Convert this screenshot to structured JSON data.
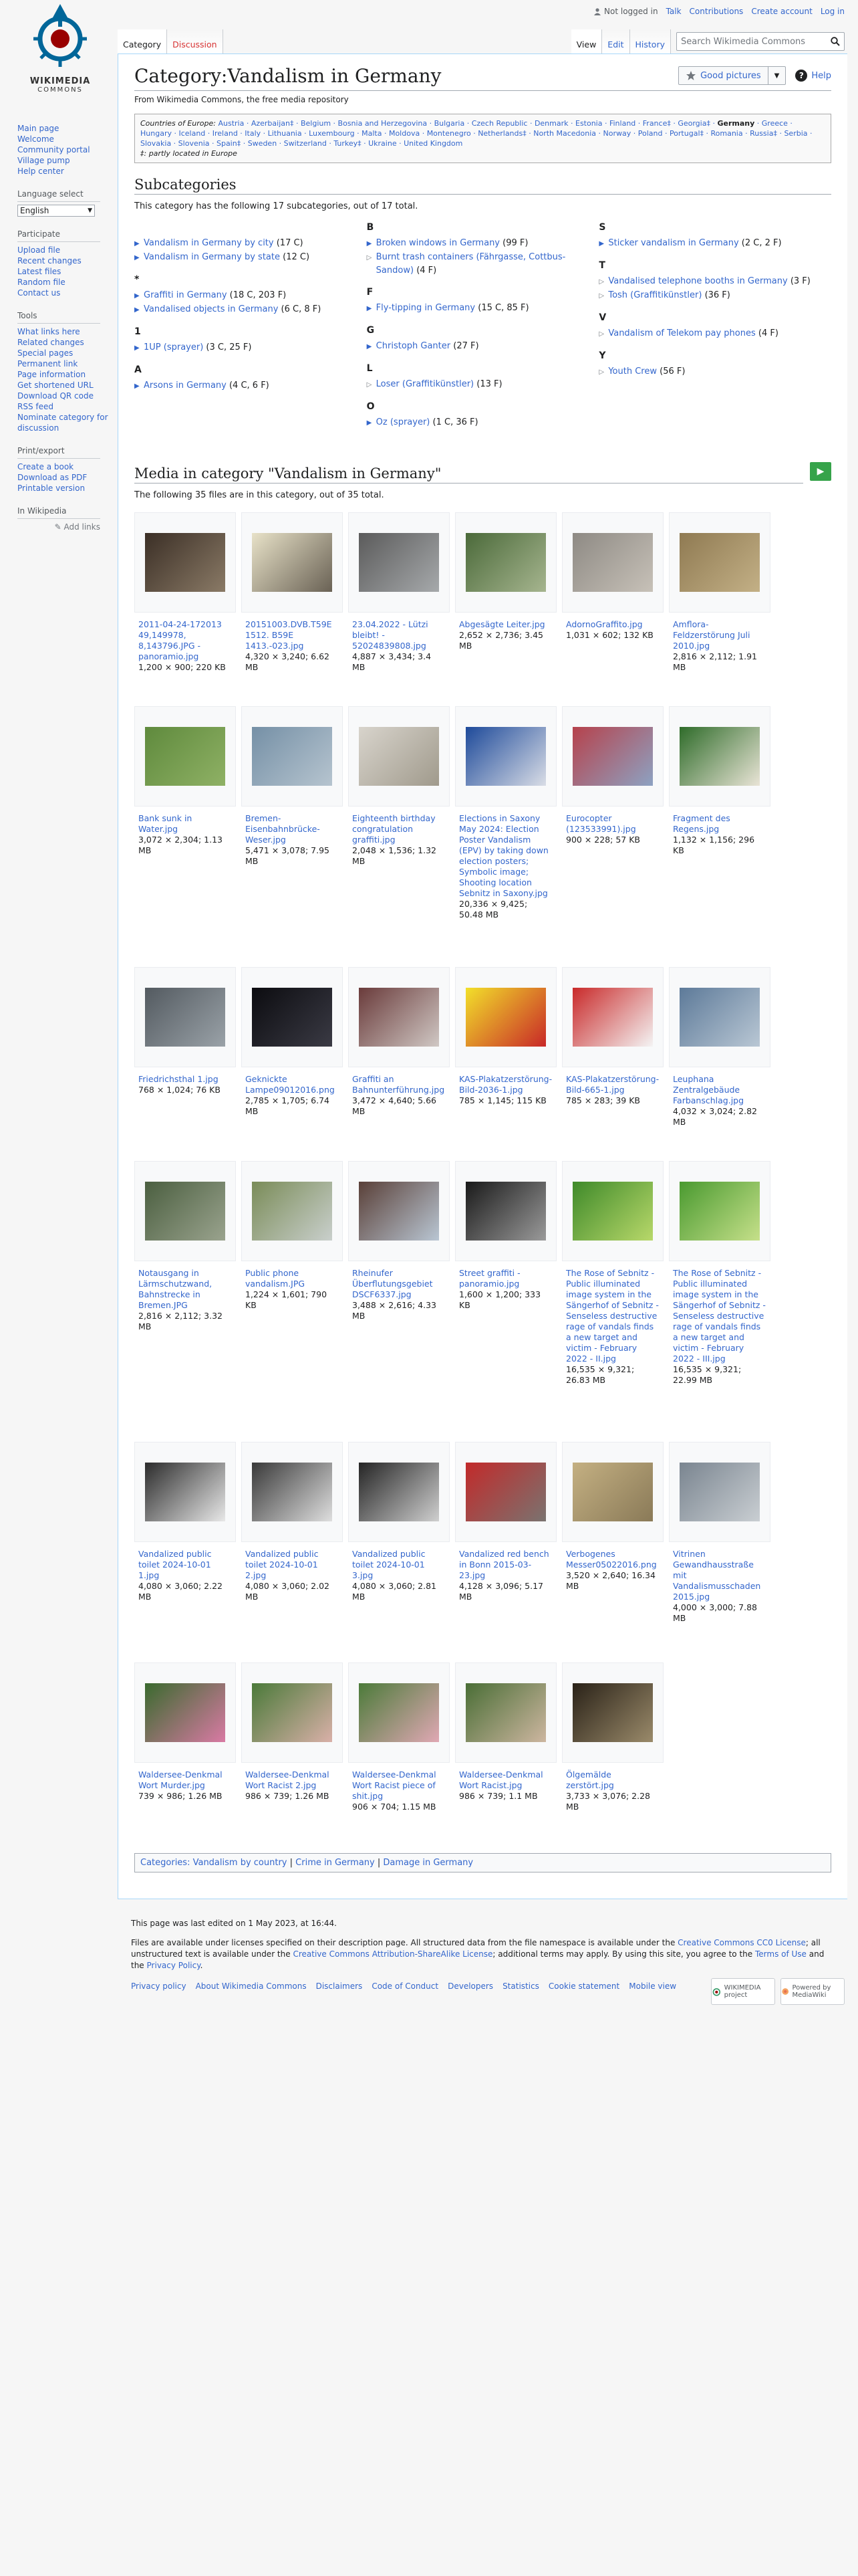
{
  "logo": {
    "wordmark_top": "WIKIMEDIA",
    "wordmark_bottom": "COMMONS"
  },
  "personal": {
    "not_logged_in": "Not logged in",
    "talk": "Talk",
    "contributions": "Contributions",
    "create_account": "Create account",
    "log_in": "Log in"
  },
  "tabs": {
    "category": "Category",
    "discussion": "Discussion",
    "view": "View",
    "edit": "Edit",
    "history": "History"
  },
  "search": {
    "placeholder": "Search Wikimedia Commons"
  },
  "sidebar": {
    "nav": [
      "Main page",
      "Welcome",
      "Community portal",
      "Village pump",
      "Help center"
    ],
    "language_heading": "Language select",
    "language_value": "English",
    "participate_heading": "Participate",
    "participate": [
      "Upload file",
      "Recent changes",
      "Latest files",
      "Random file",
      "Contact us"
    ],
    "tools_heading": "Tools",
    "tools": [
      "What links here",
      "Related changes",
      "Special pages",
      "Permanent link",
      "Page information",
      "Get shortened URL",
      "Download QR code",
      "RSS feed",
      "Nominate category for discussion"
    ],
    "print_heading": "Print/export",
    "print": [
      "Create a book",
      "Download as PDF",
      "Printable version"
    ],
    "wiki_heading": "In Wikipedia",
    "add_links": "Add links"
  },
  "page": {
    "title": "Category:Vandalism in Germany",
    "sitesub": "From Wikimedia Commons, the free media repository",
    "good_pictures": "Good pictures",
    "help": "Help"
  },
  "countries": {
    "label": "Countries of Europe:",
    "list": "Austria · Azerbaijan‡ · Belgium · Bosnia and Herzegovina · Bulgaria · Czech Republic · Denmark · Estonia · Finland · France‡ · Georgia‡ ·",
    "current": "Germany",
    "list2": "· Greece · Hungary · Iceland · Ireland · Italy · Lithuania · Luxembourg · Malta · Moldova · Montenegro · Netherlands‡ · North Macedonia · Norway · Poland · Portugal‡ · Romania · Russia‡ · Serbia · Slovakia · Slovenia · Spain‡ · Sweden · Switzerland · Turkey‡ · Ukraine · United Kingdom",
    "note": "‡: partly located in Europe"
  },
  "subcategories": {
    "heading": "Subcategories",
    "intro": "This category has the following 17 subcategories, out of 17 total.",
    "columns": [
      [
        {
          "letter": "",
          "items": [
            {
              "name": "Vandalism in Germany by city",
              "count": "(17 C)",
              "expandable": true
            },
            {
              "name": "Vandalism in Germany by state",
              "count": "(12 C)",
              "expandable": true
            }
          ]
        },
        {
          "letter": "*",
          "items": [
            {
              "name": "Graffiti in Germany",
              "count": "(18 C, 203 F)",
              "expandable": true
            },
            {
              "name": "Vandalised objects in Germany",
              "count": "(6 C, 8 F)",
              "expandable": true
            }
          ]
        },
        {
          "letter": "1",
          "items": [
            {
              "name": "1UP (sprayer)",
              "count": "(3 C, 25 F)",
              "expandable": true
            }
          ]
        },
        {
          "letter": "A",
          "items": [
            {
              "name": "Arsons in Germany",
              "count": "(4 C, 6 F)",
              "expandable": true
            }
          ]
        }
      ],
      [
        {
          "letter": "B",
          "items": [
            {
              "name": "Broken windows in Germany",
              "count": "(99 F)",
              "expandable": true
            },
            {
              "name": "Burnt trash containers (Fährgasse, Cottbus-Sandow)",
              "count": "(4 F)",
              "expandable": false
            }
          ]
        },
        {
          "letter": "F",
          "items": [
            {
              "name": "Fly-tipping in Germany",
              "count": "(15 C, 85 F)",
              "expandable": true
            }
          ]
        },
        {
          "letter": "G",
          "items": [
            {
              "name": "Christoph Ganter",
              "count": "(27 F)",
              "expandable": true
            }
          ]
        },
        {
          "letter": "L",
          "items": [
            {
              "name": "Loser (Graffitikünstler)",
              "count": "(13 F)",
              "expandable": false
            }
          ]
        },
        {
          "letter": "O",
          "items": [
            {
              "name": "Oz (sprayer)",
              "count": "(1 C, 36 F)",
              "expandable": true
            }
          ]
        }
      ],
      [
        {
          "letter": "S",
          "items": [
            {
              "name": "Sticker vandalism in Germany",
              "count": "(2 C, 2 F)",
              "expandable": true
            }
          ]
        },
        {
          "letter": "T",
          "items": [
            {
              "name": "Vandalised telephone booths in Germany",
              "count": "(3 F)",
              "expandable": false
            },
            {
              "name": "Tosh (Graffitikünstler)",
              "count": "(36 F)",
              "expandable": false
            }
          ]
        },
        {
          "letter": "V",
          "items": [
            {
              "name": "Vandalism of Telekom pay phones",
              "count": "(4 F)",
              "expandable": false
            }
          ]
        },
        {
          "letter": "Y",
          "items": [
            {
              "name": "Youth Crew",
              "count": "(56 F)",
              "expandable": false
            }
          ]
        }
      ]
    ]
  },
  "media": {
    "heading": "Media in category \"Vandalism in Germany\"",
    "intro": "The following 35 files are in this category, out of 35 total.",
    "files": [
      {
        "name": "2011-04-24-172013 49,149978, 8,143796.JPG - panoramio.jpg",
        "meta": "1,200 × 900; 220 KB",
        "c1": "#3b2f26",
        "c2": "#8a7a66"
      },
      {
        "name": "20151003.DVB.T59E 1512. B59E 1413.-023.jpg",
        "meta": "4,320 × 3,240; 6.62 MB",
        "c1": "#e8e2c8",
        "c2": "#6a6255"
      },
      {
        "name": "23.04.2022 - Lützi bleibt! - 52024839808.jpg",
        "meta": "4,887 × 3,434; 3.4 MB",
        "c1": "#5b5b5b",
        "c2": "#a6a9ab"
      },
      {
        "name": "Abgesägte Leiter.jpg",
        "meta": "2,652 × 2,736; 3.45 MB",
        "c1": "#4b6a3a",
        "c2": "#a6b58f"
      },
      {
        "name": "AdornoGraffito.jpg",
        "meta": "1,031 × 602; 132 KB",
        "c1": "#8e8a84",
        "c2": "#c7c1b8"
      },
      {
        "name": "Amflora-Feldzerstörung Juli 2010.jpg",
        "meta": "2,816 × 2,112; 1.91 MB",
        "c1": "#8f7a52",
        "c2": "#c3b086"
      },
      {
        "name": "Bank sunk in Water.jpg",
        "meta": "3,072 × 2,304; 1.13 MB",
        "c1": "#5f8a3d",
        "c2": "#8fb165"
      },
      {
        "name": "Bremen-Eisenbahnbrücke-Weser.jpg",
        "meta": "5,471 × 3,078; 7.95 MB",
        "c1": "#7590a6",
        "c2": "#b6c4cf"
      },
      {
        "name": "Eighteenth birthday congratulation graffiti.jpg",
        "meta": "2,048 × 1,536; 1.32 MB",
        "c1": "#d8d4cc",
        "c2": "#a09a8c"
      },
      {
        "name": "Elections in Saxony May 2024: Election Poster Vandalism (EPV) by taking down election posters; Symbolic image; Shooting location Sebnitz in Saxony.jpg",
        "meta": "20,336 × 9,425; 50.48 MB",
        "c1": "#1e4a9a",
        "c2": "#d9dde6"
      },
      {
        "name": "Eurocopter (123533991).jpg",
        "meta": "900 × 228; 57 KB",
        "c1": "#b6424c",
        "c2": "#8da2c2"
      },
      {
        "name": "Fragment des Regens.jpg",
        "meta": "1,132 × 1,156; 296 KB",
        "c1": "#2f6c2a",
        "c2": "#e9e4d6"
      },
      {
        "name": "Friedrichsthal 1.jpg",
        "meta": "768 × 1,024; 76 KB",
        "c1": "#535a60",
        "c2": "#9aa2a8"
      },
      {
        "name": "Geknickte Lampe09012016.png",
        "meta": "2,785 × 1,705; 6.74 MB",
        "c1": "#0c0c10",
        "c2": "#3a3a44"
      },
      {
        "name": "Graffiti an Bahnunterführung.jpg",
        "meta": "3,472 × 4,640; 5.66 MB",
        "c1": "#6a3b3b",
        "c2": "#d0c8c4"
      },
      {
        "name": "KAS-Plakatzerstörung-Bild-2036-1.jpg",
        "meta": "785 × 1,145; 115 KB",
        "c1": "#f2e02a",
        "c2": "#c82828"
      },
      {
        "name": "KAS-Plakatzerstörung-Bild-665-1.jpg",
        "meta": "785 × 283; 39 KB",
        "c1": "#c92a2a",
        "c2": "#f4f4f4"
      },
      {
        "name": "Leuphana Zentralgebäude Farbanschlag.jpg",
        "meta": "4,032 × 3,024; 2.82 MB",
        "c1": "#5d7a99",
        "c2": "#b9c7d4"
      },
      {
        "name": "Notausgang in Lärmschutzwand, Bahnstrecke in Bremen.JPG",
        "meta": "2,816 × 2,112; 3.32 MB",
        "c1": "#4b5f40",
        "c2": "#9aa38e"
      },
      {
        "name": "Public phone vandalism.JPG",
        "meta": "1,224 × 1,601; 790 KB",
        "c1": "#7a8c58",
        "c2": "#c9cfcc"
      },
      {
        "name": "Rheinufer Überflutungsgebiet DSCF6337.jpg",
        "meta": "3,488 × 2,616; 4.33 MB",
        "c1": "#5a4038",
        "c2": "#b9c6d3"
      },
      {
        "name": "Street graffiti - panoramio.jpg",
        "meta": "1,600 × 1,200; 333 KB",
        "c1": "#1a1a1a",
        "c2": "#9a9a9a"
      },
      {
        "name": "The Rose of Sebnitz - Public illuminated image system in the Sängerhof of Sebnitz - Senseless destructive rage of vandals finds a new target and victim - February 2022 - II.jpg",
        "meta": "16,535 × 9,321; 26.83 MB",
        "c1": "#3f8a2a",
        "c2": "#b8d86a"
      },
      {
        "name": "The Rose of Sebnitz - Public illuminated image system in the Sängerhof of Sebnitz - Senseless destructive rage of vandals finds a new target and victim - February 2022 - III.jpg",
        "meta": "16,535 × 9,321; 22.99 MB",
        "c1": "#4a9a30",
        "c2": "#c6e08a"
      },
      {
        "name": "Vandalized public toilet 2024-10-01 1.jpg",
        "meta": "4,080 × 3,060; 2.22 MB",
        "c1": "#2c2c2c",
        "c2": "#e8e8e8"
      },
      {
        "name": "Vandalized public toilet 2024-10-01 2.jpg",
        "meta": "4,080 × 3,060; 2.02 MB",
        "c1": "#3a3a3a",
        "c2": "#dedede"
      },
      {
        "name": "Vandalized public toilet 2024-10-01 3.jpg",
        "meta": "4,080 × 3,060; 2.81 MB",
        "c1": "#252525",
        "c2": "#cfcfcf"
      },
      {
        "name": "Vandalized red bench in Bonn 2015-03-23.jpg",
        "meta": "4,128 × 3,096; 5.17 MB",
        "c1": "#c22a2a",
        "c2": "#7a7370"
      },
      {
        "name": "Verbogenes Messer05022016.png",
        "meta": "3,520 × 2,640; 16.34 MB",
        "c1": "#c4b082",
        "c2": "#8a7a58"
      },
      {
        "name": "Vitrinen Gewandhausstraße mit Vandalismusschaden 2015.jpg",
        "meta": "4,000 × 3,000; 7.88 MB",
        "c1": "#7a8590",
        "c2": "#c9ced2"
      },
      {
        "name": "Waldersee-Denkmal Wort Murder.jpg",
        "meta": "739 × 986; 1.26 MB",
        "c1": "#3a6a2e",
        "c2": "#d97aa4"
      },
      {
        "name": "Waldersee-Denkmal Wort Racist 2.jpg",
        "meta": "986 × 739; 1.26 MB",
        "c1": "#4b7a3a",
        "c2": "#d9b0a8"
      },
      {
        "name": "Waldersee-Denkmal Wort Racist piece of shit.jpg",
        "meta": "906 × 704; 1.15 MB",
        "c1": "#4c7b3a",
        "c2": "#e0a8b4"
      },
      {
        "name": "Waldersee-Denkmal Wort Racist.jpg",
        "meta": "986 × 739; 1.1 MB",
        "c1": "#4a6e36",
        "c2": "#cdb6a0"
      },
      {
        "name": "Ölgemälde zerstört.jpg",
        "meta": "3,733 × 3,076; 2.28 MB",
        "c1": "#2a2218",
        "c2": "#9a8a6a"
      }
    ]
  },
  "catlinks": {
    "label": "Categories:",
    "links": [
      "Vandalism by country",
      "Crime in Germany",
      "Damage in Germany"
    ]
  },
  "footer": {
    "lastmod": "This page was last edited on 1 May 2023, at 16:44.",
    "license_a": "Files are available under licenses specified on their description page. All structured data from the file namespace is available under the",
    "cc0": "Creative Commons CC0 License",
    "license_b": "; all unstructured text is available under the",
    "ccbysa": "Creative Commons Attribution-ShareAlike License",
    "license_c": "; additional terms may apply. By using this site, you agree to the",
    "terms": "Terms of Use",
    "and": "and the",
    "privacy": "Privacy Policy",
    "places": [
      "Privacy policy",
      "About Wikimedia Commons",
      "Disclaimers",
      "Code of Conduct",
      "Developers",
      "Statistics",
      "Cookie statement",
      "Mobile view"
    ],
    "badge1": "WIKIMEDIA project",
    "badge2": "Powered by MediaWiki"
  },
  "colors": {
    "link": "#3366cc",
    "red_link": "#d73333",
    "green_button": "#36a34a"
  }
}
